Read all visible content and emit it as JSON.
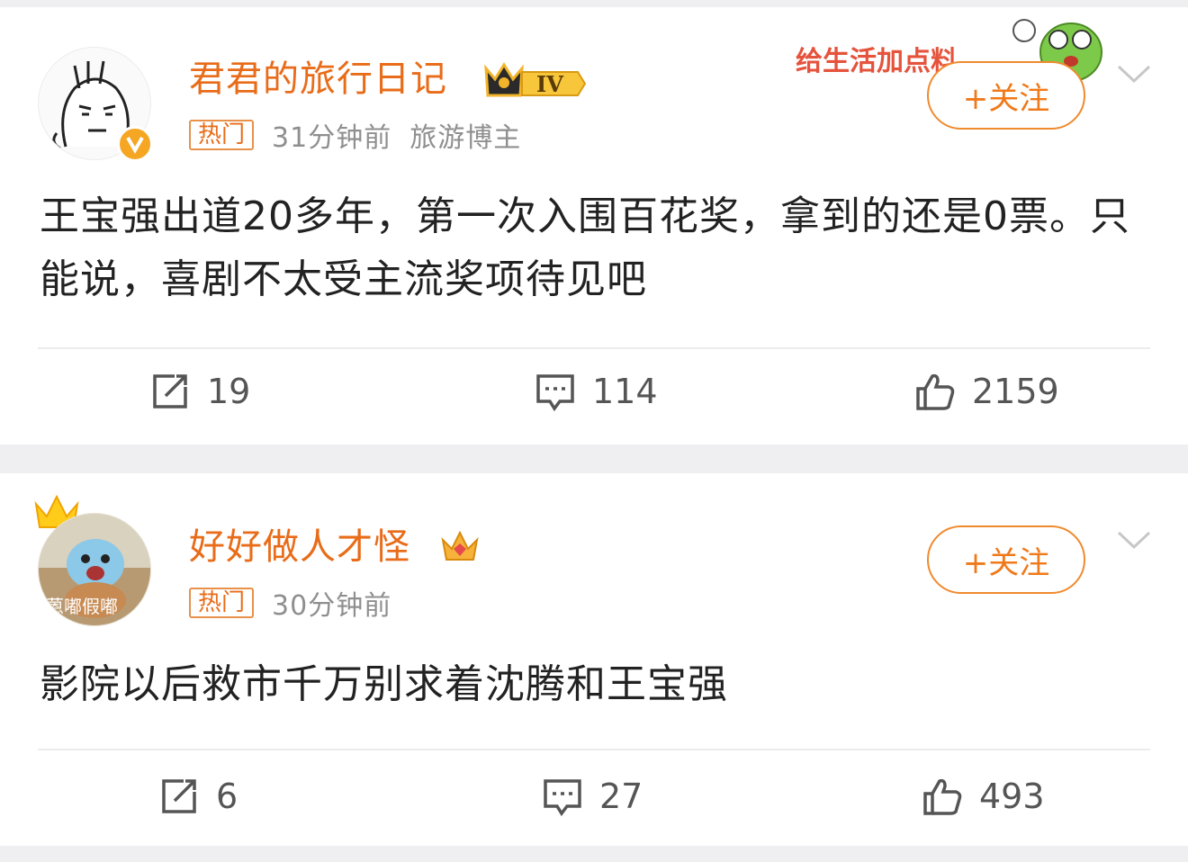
{
  "posts": [
    {
      "username": "君君的旅行日记",
      "level_badge": "IV",
      "hot_tag": "热门",
      "time": "31分钟前",
      "tag": "旅游博主",
      "follow_label": "+关注",
      "sticker_text": "给生活加点料",
      "content": "王宝强出道20多年，第一次入围百花奖，拿到的还是0票。只能说，喜剧不太受主流奖项待见吧",
      "reposts": "19",
      "comments": "114",
      "likes": "2159"
    },
    {
      "username": "好好做人才怪",
      "avatar_text": "蒽嘟假嘟",
      "hot_tag": "热门",
      "time": "30分钟前",
      "follow_label": "+关注",
      "content": "影院以后救市千万别求着沈腾和王宝强",
      "reposts": "6",
      "comments": "27",
      "likes": "493"
    }
  ],
  "colors": {
    "username": "#e86c19",
    "follow": "#f08a2e",
    "meta": "#8f8f8f",
    "content": "#222222"
  },
  "icons": [
    "repost-icon",
    "comment-icon",
    "like-icon",
    "chevron-down-icon",
    "crown-icon",
    "verified-icon"
  ]
}
